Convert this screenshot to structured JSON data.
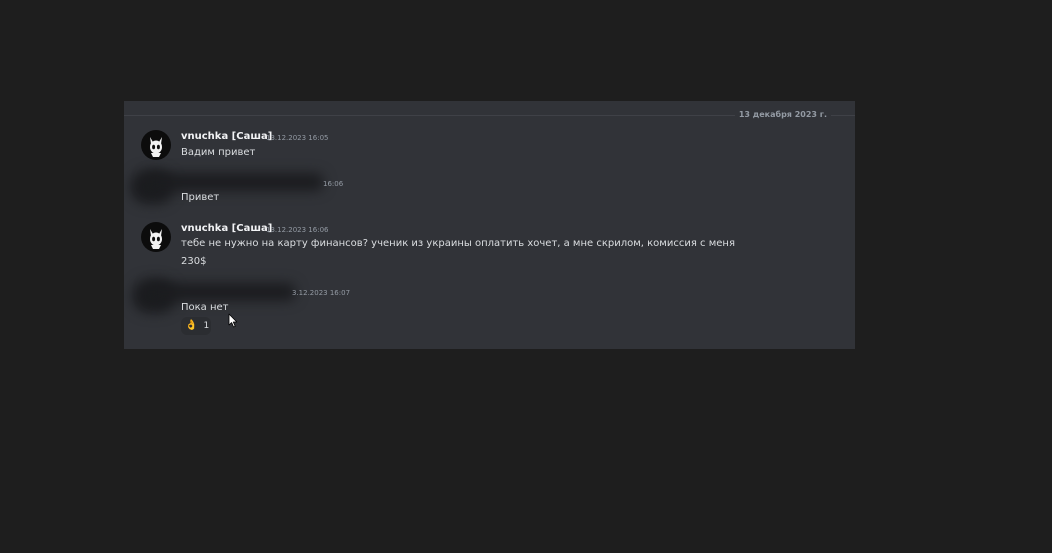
{
  "chat": {
    "date_divider": "13 декабря 2023 г.",
    "messages": [
      {
        "author": "vnuchka [Саша]",
        "time": "13.12.2023 16:05",
        "lines": [
          "Вадим привет"
        ]
      },
      {
        "author": "",
        "time": "13.12.2023 16:06",
        "time_visible": "16:06",
        "lines": [
          "Привет"
        ]
      },
      {
        "author": "vnuchka [Саша]",
        "time": "13.12.2023 16:06",
        "lines": [
          "тебе не нужно на карту финансов? ученик из украины оплатить хочет, а мне скрилом, комиссия с меня",
          "230$"
        ]
      },
      {
        "author": "",
        "time": "13.12.2023 16:07",
        "time_visible": "3.12.2023 16:07",
        "lines": [
          "Пока нет"
        ],
        "reaction": {
          "emoji": "👌",
          "count": "1"
        }
      }
    ]
  },
  "colors": {
    "page_bg": "#1e1e1e",
    "chat_bg": "#313338",
    "text": "#dbdee1",
    "muted": "#949ba4",
    "reaction_emoji": "#f0b232"
  },
  "icons": {
    "avatar": "horned-mask-icon",
    "cursor": "mouse-pointer-icon"
  }
}
